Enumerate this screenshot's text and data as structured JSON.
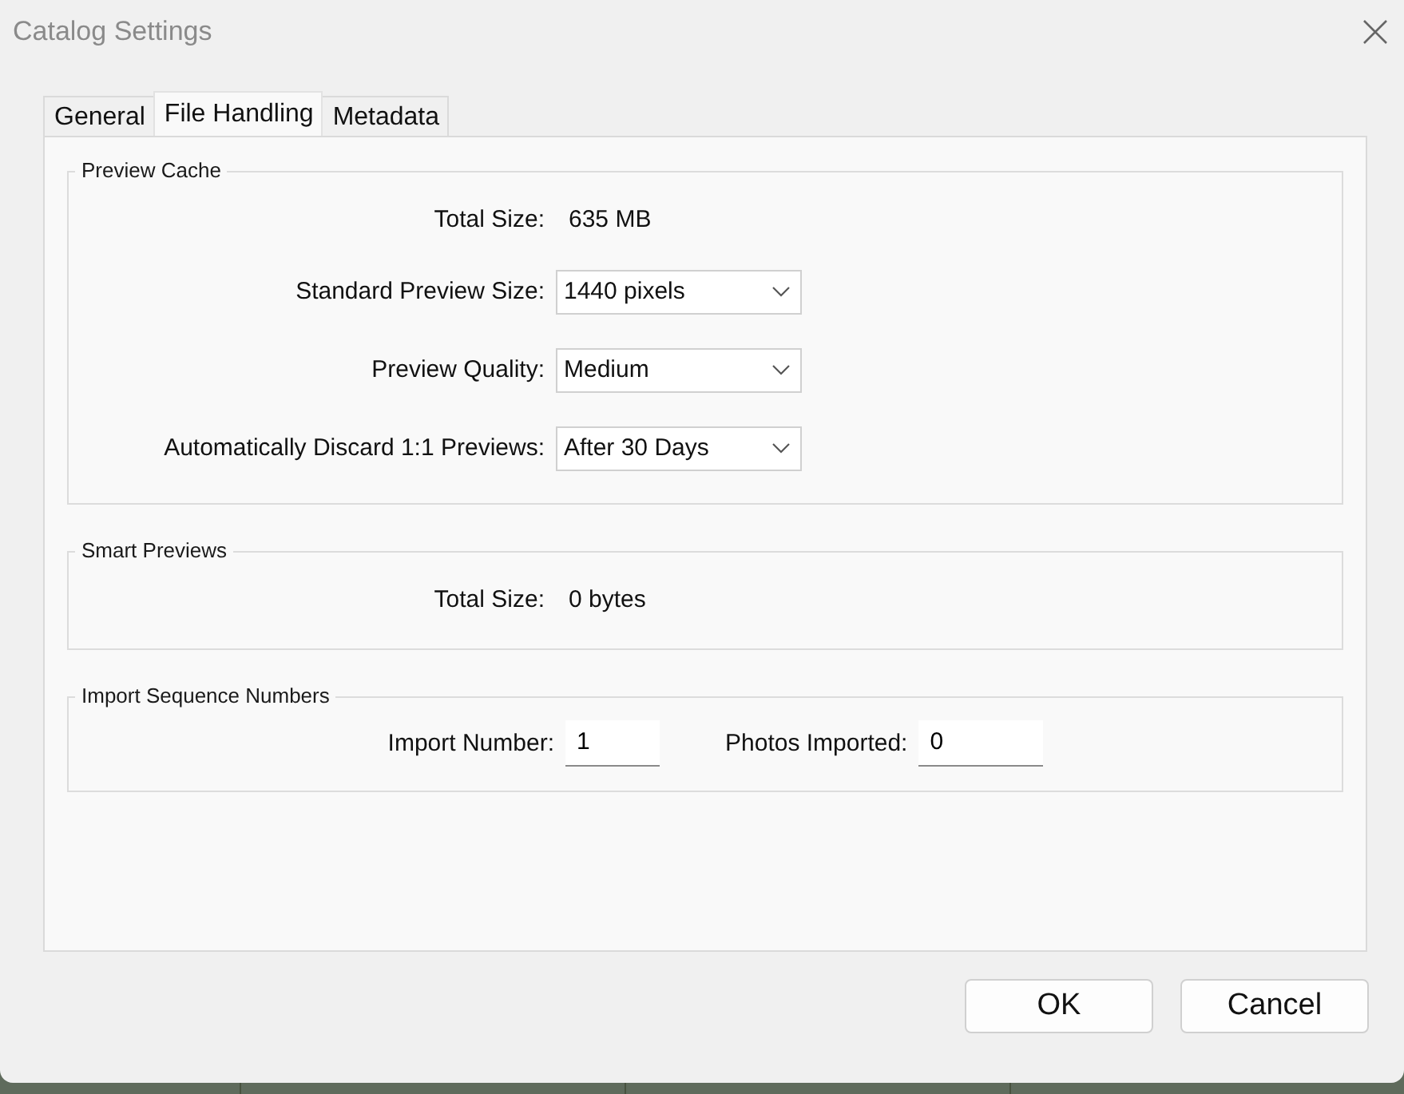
{
  "window": {
    "title": "Catalog Settings"
  },
  "tabs": [
    {
      "label": "General",
      "selected": false
    },
    {
      "label": "File Handling",
      "selected": true
    },
    {
      "label": "Metadata",
      "selected": false
    }
  ],
  "groups": [
    {
      "title": "Preview Cache",
      "rows": [
        {
          "kind": "value",
          "label": "Total Size:",
          "value": "635 MB"
        },
        {
          "kind": "dropdown",
          "label": "Standard Preview Size:",
          "value": "1440 pixels"
        },
        {
          "kind": "dropdown",
          "label": "Preview Quality:",
          "value": "Medium"
        },
        {
          "kind": "dropdown",
          "label": "Automatically Discard 1:1 Previews:",
          "value": "After 30 Days"
        }
      ]
    },
    {
      "title": "Smart Previews",
      "rows": [
        {
          "kind": "value",
          "label": "Total Size:",
          "value": "0 bytes"
        }
      ]
    },
    {
      "title": "Import Sequence Numbers",
      "rows": [
        {
          "kind": "fields",
          "fields": [
            {
              "label": "Import Number:",
              "value": "1"
            },
            {
              "label": "Photos Imported:",
              "value": "0"
            }
          ]
        }
      ]
    }
  ],
  "buttons": [
    "OK",
    "Cancel"
  ]
}
